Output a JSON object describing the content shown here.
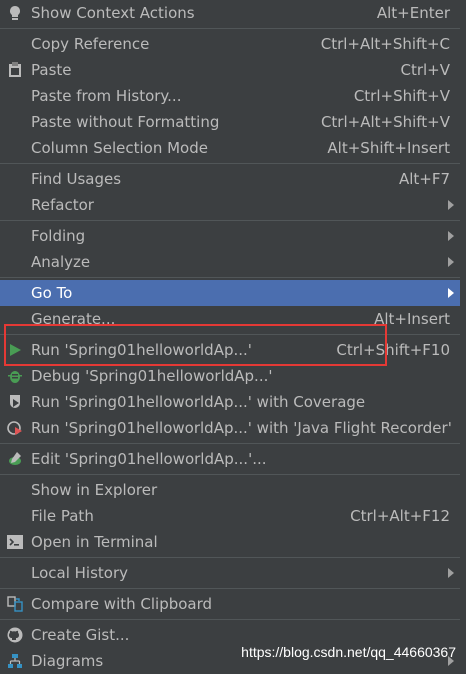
{
  "menu": {
    "items": [
      {
        "label": "Show Context Actions",
        "shortcut": "Alt+Enter",
        "icon": "bulb-icon"
      },
      {
        "label": "Copy Reference",
        "shortcut": "Ctrl+Alt+Shift+C"
      },
      {
        "label": "Paste",
        "shortcut": "Ctrl+V",
        "icon": "clipboard-icon"
      },
      {
        "label": "Paste from History...",
        "shortcut": "Ctrl+Shift+V"
      },
      {
        "label": "Paste without Formatting",
        "shortcut": "Ctrl+Alt+Shift+V"
      },
      {
        "label": "Column Selection Mode",
        "shortcut": "Alt+Shift+Insert"
      },
      {
        "label": "Find Usages",
        "shortcut": "Alt+F7"
      },
      {
        "label": "Refactor",
        "submenu": true
      },
      {
        "label": "Folding",
        "submenu": true
      },
      {
        "label": "Analyze",
        "submenu": true
      },
      {
        "label": "Go To",
        "submenu": true,
        "selected": true
      },
      {
        "label": "Generate...",
        "shortcut": "Alt+Insert"
      },
      {
        "label": "Run 'Spring01helloworldAp...'",
        "shortcut": "Ctrl+Shift+F10",
        "icon": "run-icon"
      },
      {
        "label": "Debug 'Spring01helloworldAp...'",
        "icon": "debug-icon"
      },
      {
        "label": "Run 'Spring01helloworldAp...' with Coverage",
        "icon": "coverage-icon"
      },
      {
        "label": "Run 'Spring01helloworldAp...' with 'Java Flight Recorder'",
        "icon": "flight-recorder-icon"
      },
      {
        "label": "Edit 'Spring01helloworldAp...'...",
        "icon": "edit-config-icon"
      },
      {
        "label": "Show in Explorer"
      },
      {
        "label": "File Path",
        "shortcut": "Ctrl+Alt+F12"
      },
      {
        "label": "Open in Terminal",
        "icon": "terminal-icon"
      },
      {
        "label": "Local History",
        "submenu": true
      },
      {
        "label": "Compare with Clipboard",
        "icon": "compare-icon"
      },
      {
        "label": "Create Gist...",
        "icon": "github-icon"
      },
      {
        "label": "Diagrams",
        "icon": "diagram-icon"
      }
    ]
  },
  "watermark": "https://blog.csdn.net/qq_44660367",
  "colors": {
    "background": "#3c3f41",
    "selected": "#4b6eaf",
    "highlight_box": "#e53935",
    "run_green": "#499c54"
  }
}
